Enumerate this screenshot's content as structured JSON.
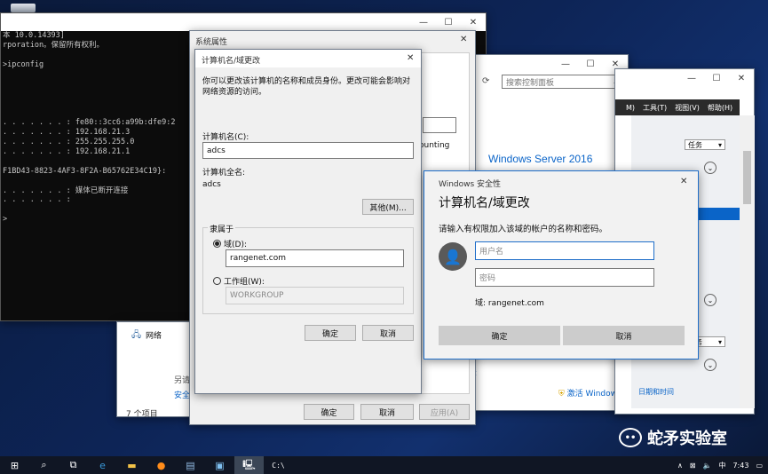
{
  "desktop": {
    "recycle_bin": ""
  },
  "cmd": {
    "lines": [
      "本 10.0.14393]",
      "rporation。保留所有权利。",
      "",
      ">ipconfig",
      "",
      "",
      "",
      "",
      "",
      ". . . . . . . : fe80::3cc6:a99b:dfe9:2",
      ". . . . . . . : 192.168.21.3",
      ". . . . . . . : 255.255.255.0",
      ". . . . . . . : 192.168.21.1",
      "",
      "F1BD43-8823-4AF3-8F2A-B65762E34C19}:",
      "",
      ". . . . . . . : 媒体已断开连接",
      ". . . . . . . :",
      "",
      ">"
    ]
  },
  "sysprops": {
    "title": "系统属性",
    "partial_text": "ounting",
    "buttons": {
      "ok": "确定",
      "cancel": "取消",
      "apply": "应用(A)"
    }
  },
  "domain_dialog": {
    "title": "计算机名/域更改",
    "description": "你可以更改该计算机的名称和成员身份。更改可能会影响对网络资源的访问。",
    "computer_name_label": "计算机名(C):",
    "computer_name_value": "adcs",
    "full_name_label": "计算机全名:",
    "full_name_value": "adcs",
    "more_button": "其他(M)...",
    "member_of_label": "隶属于",
    "domain_label": "域(D):",
    "domain_value": "rangenet.com",
    "workgroup_label": "工作组(W):",
    "workgroup_value": "WORKGROUP",
    "ok": "确定",
    "cancel": "取消"
  },
  "control_panel": {
    "search_placeholder": "搜索控制面板",
    "os_name": "Windows Server 2016",
    "activate": "激活 Windows"
  },
  "server_manager": {
    "menu_tools": "工具(T)",
    "menu_view": "视图(V)",
    "menu_help": "帮助(H)",
    "menu_m": "M)",
    "tasks": "任务",
    "tasks2": "任务",
    "datetime": "日期和时间"
  },
  "network_window": {
    "net_label": "网络",
    "item_count": "7 个项目",
    "also_see": "另请",
    "security": "安全"
  },
  "security_dialog": {
    "title": "Windows 安全性",
    "heading": "计算机名/域更改",
    "prompt": "请输入有权限加入该域的帐户的名称和密码。",
    "username_placeholder": "用户名",
    "password_placeholder": "密码",
    "domain_text": "域: rangenet.com",
    "ok": "确定",
    "cancel": "取消"
  },
  "watermark": {
    "text": "蛇矛实验室"
  },
  "taskbar": {
    "time": "7:43",
    "ime": "中"
  },
  "colors": {
    "accent": "#0a64c8",
    "security_bg": "#f2f2f2",
    "cmd_bg": "#0c0c0c"
  }
}
